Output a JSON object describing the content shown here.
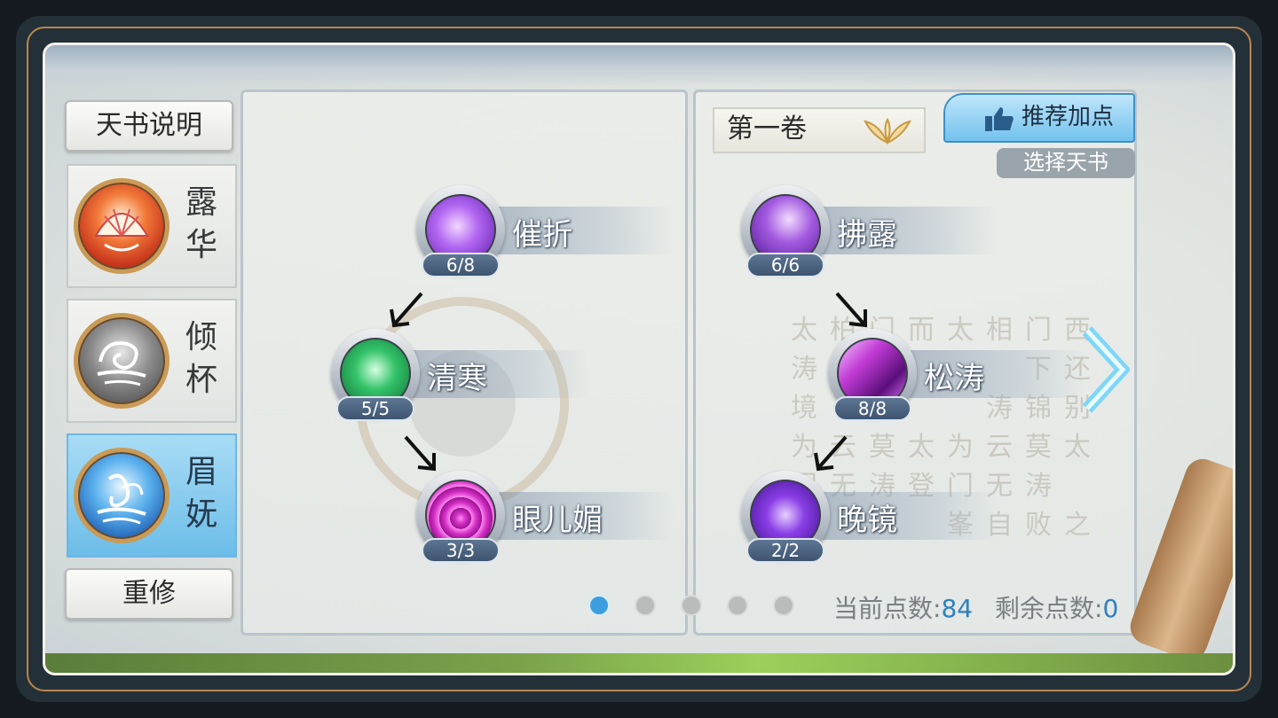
{
  "top_tabs": [
    "",
    "",
    "",
    "",
    "",
    ""
  ],
  "sidebar": {
    "description_button": "天书说明",
    "schools": [
      {
        "label": "露\n华",
        "line1": "露",
        "line2": "华",
        "active": false
      },
      {
        "label": "倾\n杯",
        "line1": "倾",
        "line2": "杯",
        "active": false
      },
      {
        "label": "眉\n妩",
        "line1": "眉",
        "line2": "妩",
        "active": true
      }
    ],
    "reset_button": "重修"
  },
  "left_tree": {
    "skills": [
      {
        "name": "催折",
        "level": "6/8",
        "icon": "purple-petal-icon"
      },
      {
        "name": "清寒",
        "level": "5/5",
        "icon": "green-figure-icon"
      },
      {
        "name": "眼儿媚",
        "level": "3/3",
        "icon": "magenta-vortex-icon"
      }
    ]
  },
  "right_tree": {
    "volume": "第一卷",
    "recommend_button": "推荐加点",
    "select_book_button": "选择天书",
    "skills": [
      {
        "name": "拂露",
        "level": "6/6",
        "icon": "purple-maiden-icon"
      },
      {
        "name": "松涛",
        "level": "8/8",
        "icon": "crystal-shard-icon"
      },
      {
        "name": "晚镜",
        "level": "2/2",
        "icon": "violet-feather-icon"
      }
    ]
  },
  "pagination": {
    "total": 5,
    "active_index": 0
  },
  "points": {
    "current_label": "当前点数:",
    "current_value": "84",
    "remaining_label": "剩余点数:",
    "remaining_value": "0"
  },
  "colors": {
    "accent": "#3c9ee0",
    "gold": "#b9854f",
    "active_school": "#6cbde9"
  }
}
